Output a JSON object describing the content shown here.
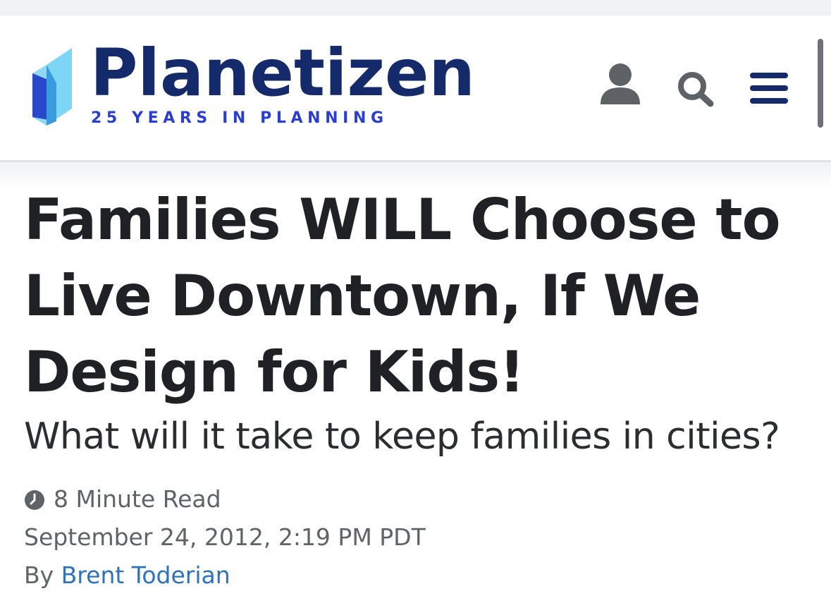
{
  "header": {
    "brand_name": "Planetizen",
    "tagline": "25 YEARS IN PLANNING",
    "icons": [
      "user-icon",
      "search-icon",
      "menu-icon"
    ],
    "colors": {
      "brand": "#152a6b",
      "tagline": "#2a3fd0",
      "logo_light": "#6fd0f3",
      "logo_dark": "#2746c8"
    }
  },
  "article": {
    "title": "Families WILL Choose to Live Downtown, If We Design for Kids!",
    "subtitle": "What will it take to keep families in cities?",
    "read_time": "8 Minute Read",
    "date": "September 24, 2012, 2:19 PM PDT",
    "by_label": "By",
    "author": "Brent Toderian",
    "colors": {
      "title": "#1f2124",
      "meta": "#5f6368",
      "author_link": "#2f72b7"
    }
  }
}
